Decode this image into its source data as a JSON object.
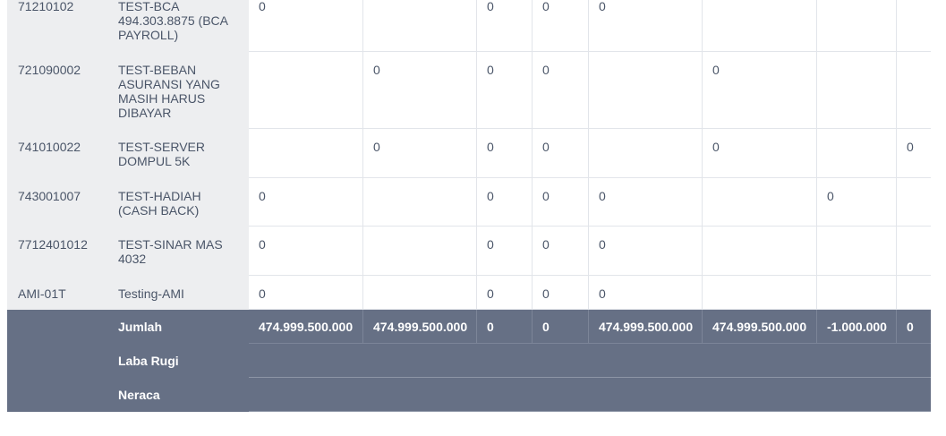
{
  "rows": [
    {
      "code": "",
      "name": "",
      "values": [
        "",
        "",
        "",
        "",
        "",
        "",
        "",
        ""
      ]
    },
    {
      "code": "71210102",
      "name": "TEST-BCA 494.303.8875 (BCA PAYROLL)",
      "values": [
        "0",
        "",
        "0",
        "0",
        "0",
        "",
        "",
        ""
      ]
    },
    {
      "code": "721090002",
      "name": "TEST-BEBAN ASURANSI YANG MASIH HARUS DIBAYAR",
      "values": [
        "",
        "0",
        "0",
        "0",
        "",
        "0",
        "",
        ""
      ]
    },
    {
      "code": "741010022",
      "name": "TEST-SERVER DOMPUL 5K",
      "values": [
        "",
        "0",
        "0",
        "0",
        "",
        "0",
        "",
        "0"
      ]
    },
    {
      "code": "743001007",
      "name": "TEST-HADIAH (CASH BACK)",
      "values": [
        "0",
        "",
        "0",
        "0",
        "0",
        "",
        "0",
        ""
      ]
    },
    {
      "code": "7712401012",
      "name": "TEST-SINAR MAS 4032",
      "values": [
        "0",
        "",
        "0",
        "0",
        "0",
        "",
        "",
        ""
      ]
    },
    {
      "code": "AMI-01T",
      "name": "Testing-AMI",
      "values": [
        "0",
        "",
        "0",
        "0",
        "0",
        "",
        "",
        ""
      ]
    }
  ],
  "footer": {
    "total_label": "Jumlah",
    "totals": [
      "474.999.500.000",
      "474.999.500.000",
      "0",
      "0",
      "474.999.500.000",
      "474.999.500.000",
      "-1.000.000",
      "0"
    ],
    "laba_rugi_label": "Laba Rugi",
    "neraca_label": "Neraca"
  }
}
